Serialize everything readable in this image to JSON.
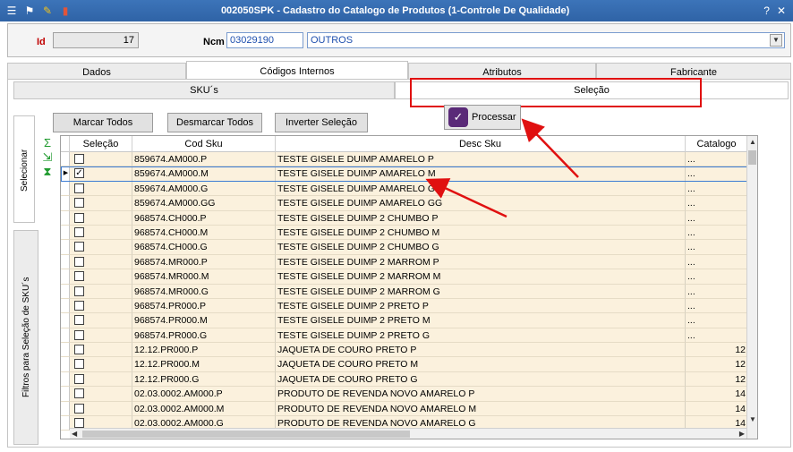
{
  "window": {
    "title": "002050SPK - Cadastro do Catalogo de Produtos (1-Controle De Qualidade)",
    "icons": [
      "menu-icon",
      "traffic-light-icon",
      "wrench-icon",
      "book-icon"
    ],
    "right_icons": [
      "help-icon",
      "close-icon"
    ]
  },
  "header": {
    "id_label": "Id",
    "id_value": "17",
    "ncm_label": "Ncm",
    "ncm_code": "03029190",
    "ncm_desc": "OUTROS"
  },
  "main_tabs": [
    {
      "label": "Dados"
    },
    {
      "label": "Códigos Internos"
    },
    {
      "label": "Atributos"
    },
    {
      "label": "Fabricante"
    }
  ],
  "sub_tabs": [
    {
      "label": "SKU´s"
    },
    {
      "label": "Seleção"
    }
  ],
  "side_tabs": {
    "selecionar": "Selecionar",
    "filtros": "Filtros para Seleção de SKU´s"
  },
  "buttons": {
    "marcar": "Marcar Todos",
    "desmarcar": "Desmarcar Todos",
    "inverter": "Inverter Seleção",
    "processar": "Processar"
  },
  "grid": {
    "columns": [
      "Seleção",
      "Cod Sku",
      "Desc Sku",
      "Catalogo"
    ],
    "rows": [
      {
        "checked": "",
        "cod": "859674.AM000.P",
        "desc": "TESTE GISELE DUIMP AMARELO P",
        "cat": "..."
      },
      {
        "checked": "✓",
        "cod": "859674.AM000.M",
        "desc": "TESTE GISELE DUIMP AMARELO M",
        "cat": "..."
      },
      {
        "checked": "",
        "cod": "859674.AM000.G",
        "desc": "TESTE GISELE DUIMP AMARELO G",
        "cat": "..."
      },
      {
        "checked": "",
        "cod": "859674.AM000.GG",
        "desc": "TESTE GISELE DUIMP AMARELO GG",
        "cat": "..."
      },
      {
        "checked": "",
        "cod": "968574.CH000.P",
        "desc": "TESTE GISELE DUIMP 2 CHUMBO P",
        "cat": "..."
      },
      {
        "checked": "",
        "cod": "968574.CH000.M",
        "desc": "TESTE GISELE DUIMP 2 CHUMBO M",
        "cat": "..."
      },
      {
        "checked": "",
        "cod": "968574.CH000.G",
        "desc": "TESTE GISELE DUIMP 2 CHUMBO G",
        "cat": "..."
      },
      {
        "checked": "",
        "cod": "968574.MR000.P",
        "desc": "TESTE GISELE DUIMP 2 MARROM P",
        "cat": "..."
      },
      {
        "checked": "",
        "cod": "968574.MR000.M",
        "desc": "TESTE GISELE DUIMP 2 MARROM M",
        "cat": "..."
      },
      {
        "checked": "",
        "cod": "968574.MR000.G",
        "desc": "TESTE GISELE DUIMP 2 MARROM G",
        "cat": "..."
      },
      {
        "checked": "",
        "cod": "968574.PR000.P",
        "desc": "TESTE GISELE DUIMP 2 PRETO P",
        "cat": "..."
      },
      {
        "checked": "",
        "cod": "968574.PR000.M",
        "desc": "TESTE GISELE DUIMP 2 PRETO M",
        "cat": "..."
      },
      {
        "checked": "",
        "cod": "968574.PR000.G",
        "desc": "TESTE GISELE DUIMP 2 PRETO G",
        "cat": "..."
      },
      {
        "checked": "",
        "cod": "12.12.PR000.P",
        "desc": "JAQUETA DE COURO PRETO P",
        "cat": "12"
      },
      {
        "checked": "",
        "cod": "12.12.PR000.M",
        "desc": "JAQUETA DE COURO PRETO M",
        "cat": "12"
      },
      {
        "checked": "",
        "cod": "12.12.PR000.G",
        "desc": "JAQUETA DE COURO PRETO G",
        "cat": "12"
      },
      {
        "checked": "",
        "cod": "02.03.0002.AM000.P",
        "desc": "PRODUTO DE REVENDA NOVO AMARELO P",
        "cat": "14"
      },
      {
        "checked": "",
        "cod": "02.03.0002.AM000.M",
        "desc": "PRODUTO DE REVENDA NOVO AMARELO M",
        "cat": "14"
      },
      {
        "checked": "",
        "cod": "02.03.0002.AM000.G",
        "desc": "PRODUTO DE REVENDA NOVO AMARELO G",
        "cat": "14"
      }
    ]
  },
  "colors": {
    "titlebar": "#2f63a6",
    "row_bg": "#fbf1dd",
    "annotation_red": "#e01010",
    "accent_purple": "#5a2a78"
  }
}
